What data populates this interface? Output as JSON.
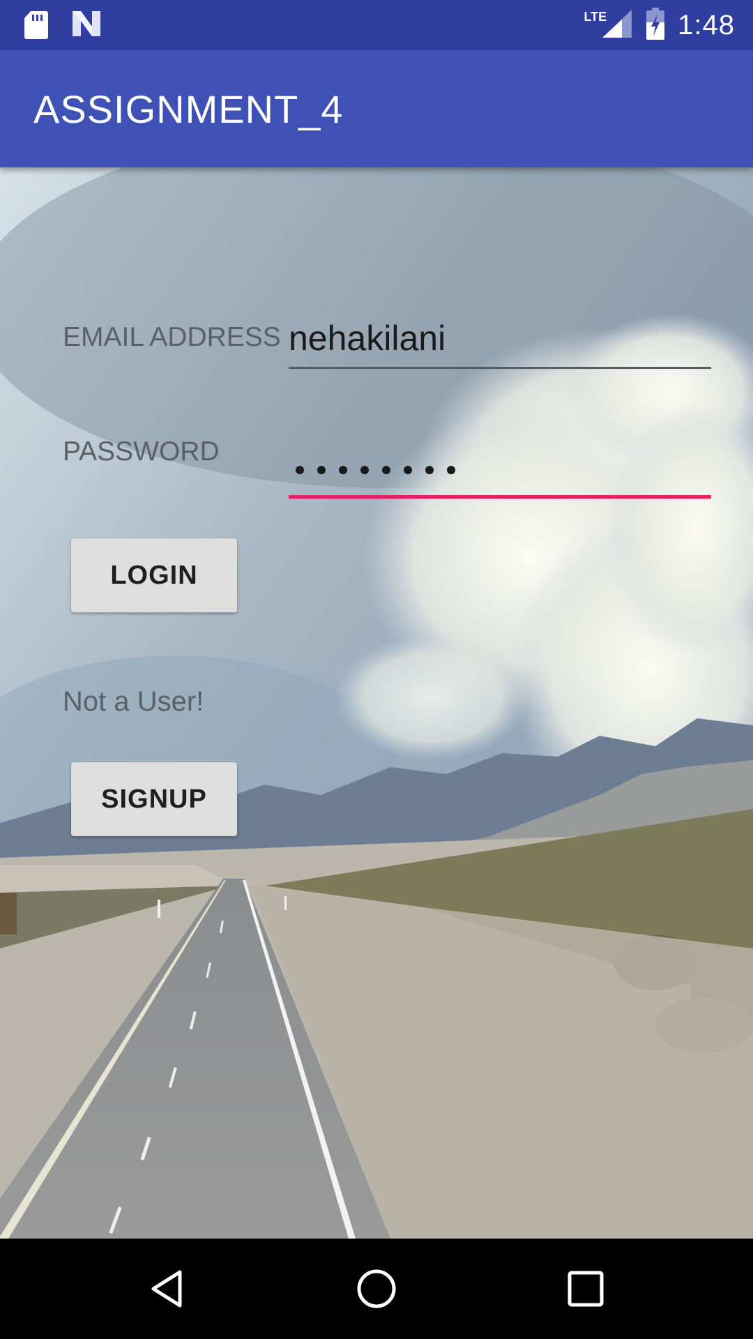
{
  "status_bar": {
    "time": "1:48",
    "network": "LTE",
    "icons": [
      "sd-card-icon",
      "n-notification-icon",
      "signal-icon",
      "battery-charging-icon"
    ]
  },
  "app_bar": {
    "title": "ASSIGNMENT_4"
  },
  "form": {
    "email_label": "EMAIL ADDRESS",
    "email_value": "nehakilani",
    "password_label": "PASSWORD",
    "password_masked_length": 8,
    "login_label": "LOGIN",
    "not_user_text": "Not a User!",
    "signup_label": "SIGNUP"
  },
  "colors": {
    "status_bar": "#303F9F",
    "app_bar": "#3F51B5",
    "accent": "#E91E63"
  },
  "nav_bar": {
    "icons": [
      "back-icon",
      "home-icon",
      "recents-icon"
    ]
  }
}
